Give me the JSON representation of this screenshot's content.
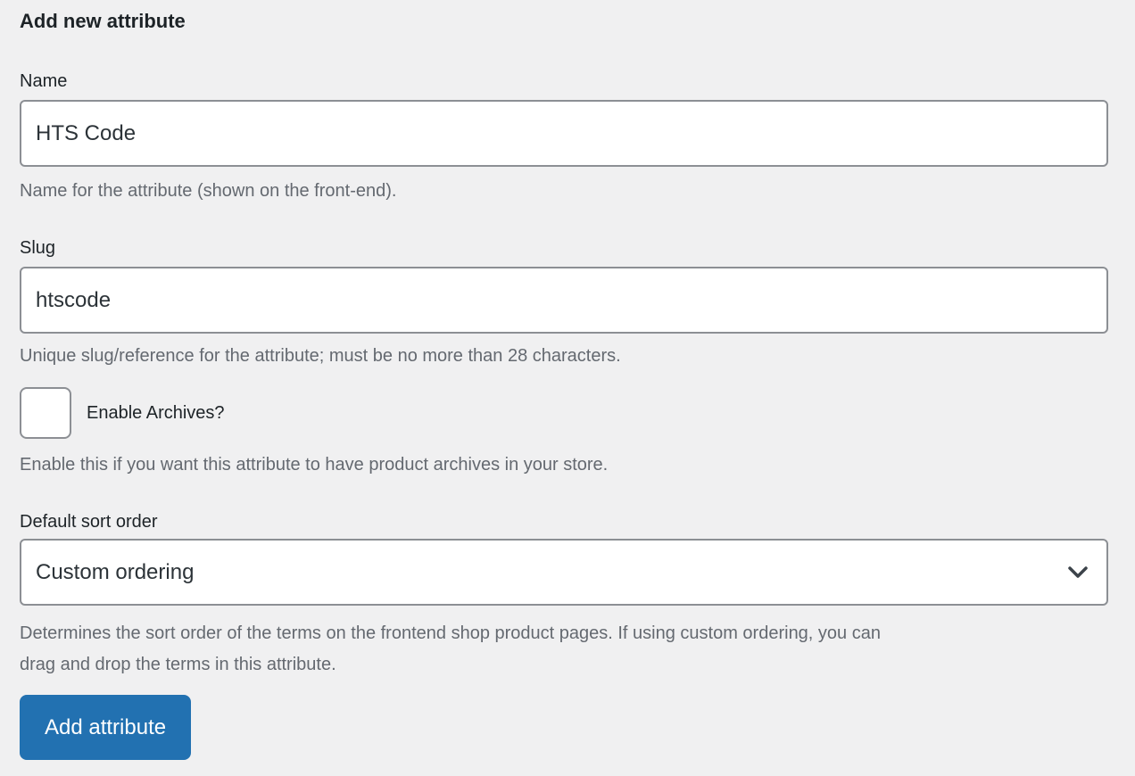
{
  "form": {
    "title": "Add new attribute",
    "fields": {
      "name": {
        "label": "Name",
        "value": "HTS Code",
        "description": "Name for the attribute (shown on the front-end)."
      },
      "slug": {
        "label": "Slug",
        "value": "htscode",
        "description": "Unique slug/reference for the attribute; must be no more than 28 characters."
      },
      "archives": {
        "label": "Enable Archives?",
        "checked": false,
        "description": "Enable this if you want this attribute to have product archives in your store."
      },
      "sort_order": {
        "label": "Default sort order",
        "selected_option": "Custom ordering",
        "description_line1": "Determines the sort order of the terms on the frontend shop product pages. If using custom ordering, you can",
        "description_line2": "drag and drop the terms in this attribute."
      }
    },
    "submit_label": "Add attribute"
  },
  "icons": {
    "select_chevron": "chevron-down-icon"
  },
  "colors": {
    "page_background": "#f0f0f1",
    "input_background": "#ffffff",
    "input_border": "#8c8f94",
    "text_primary": "#1d2327",
    "text_muted": "#646970",
    "accent_button": "#2271b1",
    "button_text": "#ffffff",
    "chevron": "#3c434a"
  }
}
